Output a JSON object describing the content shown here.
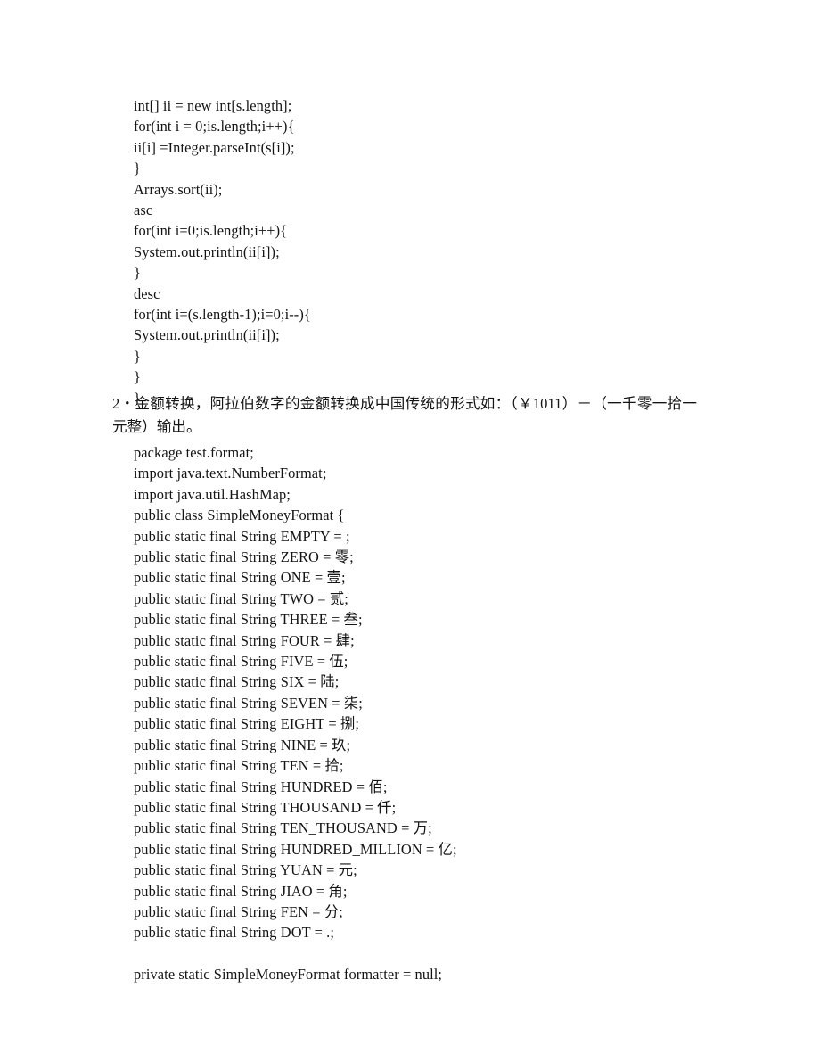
{
  "document": {
    "page_background": "#ffffff",
    "text_color": "#141414"
  },
  "code_block_1": {
    "name": "array-sort-snippet",
    "lines": [
      "int[] ii = new int[s.length];",
      "for(int i = 0;is.length;i++){",
      "ii[i] =Integer.parseInt(s[i]);",
      "}",
      "Arrays.sort(ii);",
      "asc",
      "for(int i=0;is.length;i++){",
      "System.out.println(ii[i]);",
      "}",
      "desc",
      "for(int i=(s.length-1);i=0;i--){",
      "System.out.println(ii[i]);",
      "}",
      "}",
      "}"
    ]
  },
  "problem_statement": {
    "number": "2",
    "text": "2・金额转换，阿拉伯数字的金额转换成中国传统的形式如：（￥1011）－（一千零一拾一元整）输出。"
  },
  "code_block_2": {
    "name": "simple-money-format-snippet",
    "lines": [
      "package test.format;",
      "import java.text.NumberFormat;",
      "import java.util.HashMap;",
      "public class SimpleMoneyFormat {",
      "public static final String EMPTY = ;",
      "public static final String ZERO = 零;",
      "public static final String ONE = 壹;",
      "public static final String TWO = 贰;",
      "public static final String THREE = 叁;",
      "public static final String FOUR = 肆;",
      "public static final String FIVE = 伍;",
      "public static final String SIX = 陆;",
      "public static final String SEVEN = 柒;",
      "public static final String EIGHT = 捌;",
      "public static final String NINE = 玖;",
      "public static final String TEN = 拾;",
      "public static final String HUNDRED = 佰;",
      "public static final String THOUSAND = 仟;",
      "public static final String TEN_THOUSAND = 万;",
      "public static final String HUNDRED_MILLION = 亿;",
      "public static final String YUAN = 元;",
      "public static final String JIAO = 角;",
      "public static final String FEN = 分;",
      "public static final String DOT = .;",
      "",
      "private static SimpleMoneyFormat formatter = null;"
    ]
  }
}
